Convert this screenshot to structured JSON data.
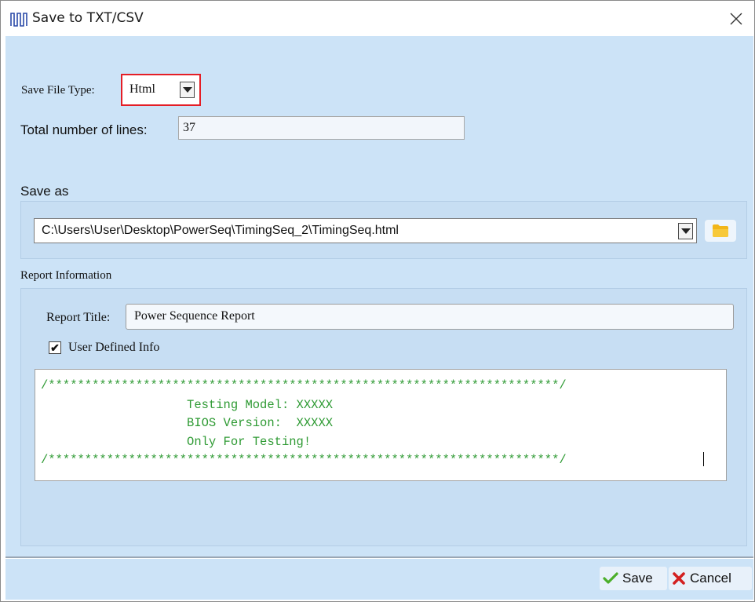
{
  "window": {
    "title": "Save to TXT/CSV"
  },
  "file_type": {
    "label": "Save File Type:",
    "value": "Html"
  },
  "total_lines": {
    "label": "Total number of lines:",
    "value": "37"
  },
  "save_as": {
    "label": "Save as",
    "path": "C:\\Users\\User\\Desktop\\PowerSeq\\TimingSeq_2\\TimingSeq.html"
  },
  "report": {
    "section_label": "Report Information",
    "title_label": "Report Title:",
    "title_value": "Power Sequence Report",
    "user_defined_label": "User Defined Info",
    "user_defined_checked": true,
    "info_lines": [
      "/**********************************************************************/",
      "                    Testing Model: XXXXX",
      "                    BIOS Version:  XXXXX",
      "                    Only For Testing!",
      "/**********************************************************************/"
    ]
  },
  "buttons": {
    "save": "Save",
    "cancel": "Cancel"
  },
  "colors": {
    "client_bg": "#cce3f7",
    "highlight_border": "#e41e26",
    "info_text": "#2e9a33",
    "save_check": "#4caf2a",
    "cancel_x": "#d32020"
  }
}
